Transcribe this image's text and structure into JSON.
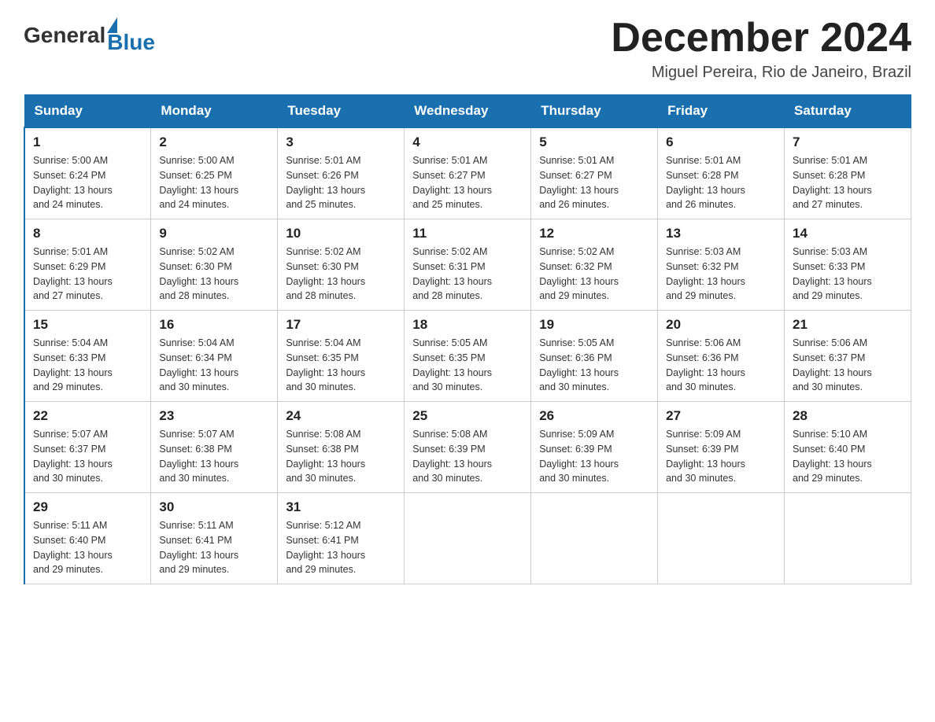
{
  "logo": {
    "general": "General",
    "blue": "Blue",
    "arrow": "▲"
  },
  "title": "December 2024",
  "subtitle": "Miguel Pereira, Rio de Janeiro, Brazil",
  "weekdays": [
    "Sunday",
    "Monday",
    "Tuesday",
    "Wednesday",
    "Thursday",
    "Friday",
    "Saturday"
  ],
  "weeks": [
    [
      {
        "day": "1",
        "sunrise": "5:00 AM",
        "sunset": "6:24 PM",
        "daylight": "13 hours and 24 minutes."
      },
      {
        "day": "2",
        "sunrise": "5:00 AM",
        "sunset": "6:25 PM",
        "daylight": "13 hours and 24 minutes."
      },
      {
        "day": "3",
        "sunrise": "5:01 AM",
        "sunset": "6:26 PM",
        "daylight": "13 hours and 25 minutes."
      },
      {
        "day": "4",
        "sunrise": "5:01 AM",
        "sunset": "6:27 PM",
        "daylight": "13 hours and 25 minutes."
      },
      {
        "day": "5",
        "sunrise": "5:01 AM",
        "sunset": "6:27 PM",
        "daylight": "13 hours and 26 minutes."
      },
      {
        "day": "6",
        "sunrise": "5:01 AM",
        "sunset": "6:28 PM",
        "daylight": "13 hours and 26 minutes."
      },
      {
        "day": "7",
        "sunrise": "5:01 AM",
        "sunset": "6:28 PM",
        "daylight": "13 hours and 27 minutes."
      }
    ],
    [
      {
        "day": "8",
        "sunrise": "5:01 AM",
        "sunset": "6:29 PM",
        "daylight": "13 hours and 27 minutes."
      },
      {
        "day": "9",
        "sunrise": "5:02 AM",
        "sunset": "6:30 PM",
        "daylight": "13 hours and 28 minutes."
      },
      {
        "day": "10",
        "sunrise": "5:02 AM",
        "sunset": "6:30 PM",
        "daylight": "13 hours and 28 minutes."
      },
      {
        "day": "11",
        "sunrise": "5:02 AM",
        "sunset": "6:31 PM",
        "daylight": "13 hours and 28 minutes."
      },
      {
        "day": "12",
        "sunrise": "5:02 AM",
        "sunset": "6:32 PM",
        "daylight": "13 hours and 29 minutes."
      },
      {
        "day": "13",
        "sunrise": "5:03 AM",
        "sunset": "6:32 PM",
        "daylight": "13 hours and 29 minutes."
      },
      {
        "day": "14",
        "sunrise": "5:03 AM",
        "sunset": "6:33 PM",
        "daylight": "13 hours and 29 minutes."
      }
    ],
    [
      {
        "day": "15",
        "sunrise": "5:04 AM",
        "sunset": "6:33 PM",
        "daylight": "13 hours and 29 minutes."
      },
      {
        "day": "16",
        "sunrise": "5:04 AM",
        "sunset": "6:34 PM",
        "daylight": "13 hours and 30 minutes."
      },
      {
        "day": "17",
        "sunrise": "5:04 AM",
        "sunset": "6:35 PM",
        "daylight": "13 hours and 30 minutes."
      },
      {
        "day": "18",
        "sunrise": "5:05 AM",
        "sunset": "6:35 PM",
        "daylight": "13 hours and 30 minutes."
      },
      {
        "day": "19",
        "sunrise": "5:05 AM",
        "sunset": "6:36 PM",
        "daylight": "13 hours and 30 minutes."
      },
      {
        "day": "20",
        "sunrise": "5:06 AM",
        "sunset": "6:36 PM",
        "daylight": "13 hours and 30 minutes."
      },
      {
        "day": "21",
        "sunrise": "5:06 AM",
        "sunset": "6:37 PM",
        "daylight": "13 hours and 30 minutes."
      }
    ],
    [
      {
        "day": "22",
        "sunrise": "5:07 AM",
        "sunset": "6:37 PM",
        "daylight": "13 hours and 30 minutes."
      },
      {
        "day": "23",
        "sunrise": "5:07 AM",
        "sunset": "6:38 PM",
        "daylight": "13 hours and 30 minutes."
      },
      {
        "day": "24",
        "sunrise": "5:08 AM",
        "sunset": "6:38 PM",
        "daylight": "13 hours and 30 minutes."
      },
      {
        "day": "25",
        "sunrise": "5:08 AM",
        "sunset": "6:39 PM",
        "daylight": "13 hours and 30 minutes."
      },
      {
        "day": "26",
        "sunrise": "5:09 AM",
        "sunset": "6:39 PM",
        "daylight": "13 hours and 30 minutes."
      },
      {
        "day": "27",
        "sunrise": "5:09 AM",
        "sunset": "6:39 PM",
        "daylight": "13 hours and 30 minutes."
      },
      {
        "day": "28",
        "sunrise": "5:10 AM",
        "sunset": "6:40 PM",
        "daylight": "13 hours and 29 minutes."
      }
    ],
    [
      {
        "day": "29",
        "sunrise": "5:11 AM",
        "sunset": "6:40 PM",
        "daylight": "13 hours and 29 minutes."
      },
      {
        "day": "30",
        "sunrise": "5:11 AM",
        "sunset": "6:41 PM",
        "daylight": "13 hours and 29 minutes."
      },
      {
        "day": "31",
        "sunrise": "5:12 AM",
        "sunset": "6:41 PM",
        "daylight": "13 hours and 29 minutes."
      },
      null,
      null,
      null,
      null
    ]
  ],
  "labels": {
    "sunrise_prefix": "Sunrise: ",
    "sunset_prefix": "Sunset: ",
    "daylight_prefix": "Daylight: "
  }
}
